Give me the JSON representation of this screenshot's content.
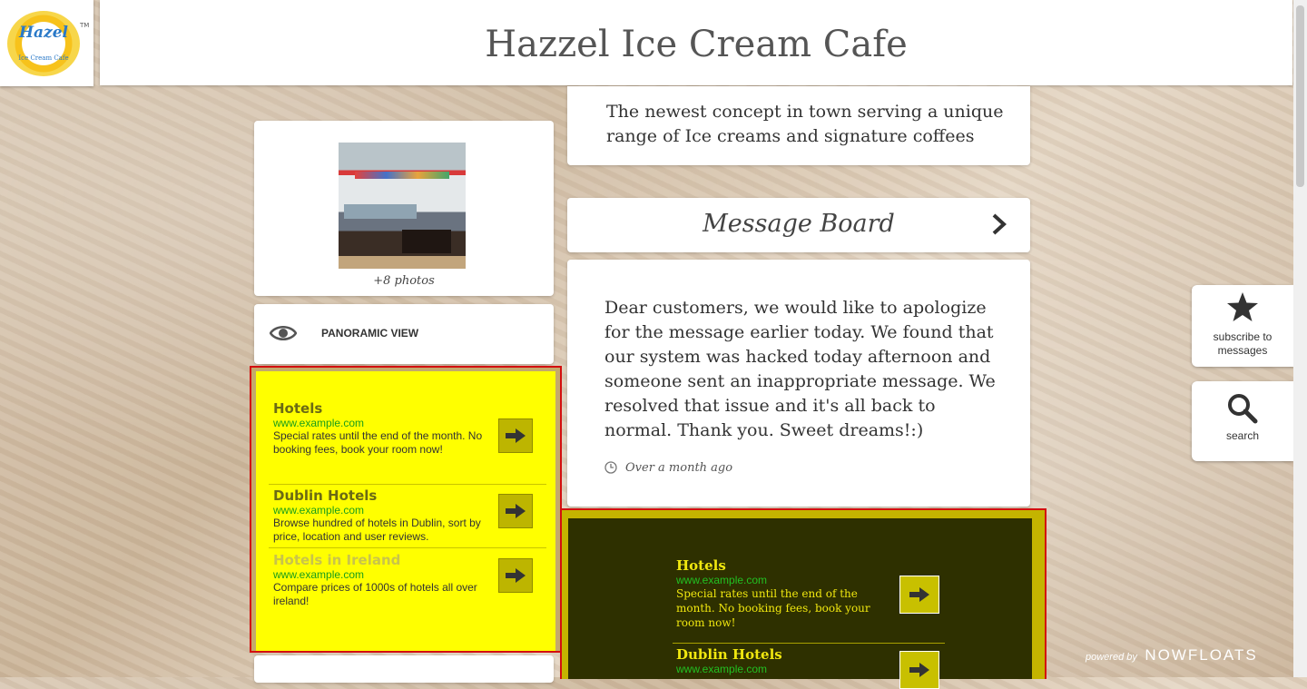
{
  "header": {
    "title": "Hazzel Ice Cream Cafe"
  },
  "logo": {
    "text": "Hazel",
    "subtext": "Ice Cream Cafe",
    "tm": "TM"
  },
  "gallery": {
    "caption": "+8 photos"
  },
  "panoramic": {
    "label": "PANORAMIC VIEW"
  },
  "ad_left": {
    "items": [
      {
        "title": "Hotels",
        "url": "www.example.com",
        "desc": "Special rates until the end of the month. No booking fees, book your room now!"
      },
      {
        "title": "Dublin Hotels",
        "url": "www.example.com",
        "desc": "Browse hundred of hotels in Dublin, sort by price, location and user reviews."
      },
      {
        "title": "Hotels in Ireland",
        "url": "www.example.com",
        "desc": "Compare prices of 1000s of hotels all over ireland!"
      }
    ]
  },
  "description": {
    "text": "The newest concept in town serving a unique range of Ice creams and signature coffees"
  },
  "message_board": {
    "title": "Message Board",
    "message": "Dear customers, we would like to apologize for the message earlier today. We found that our system was hacked today afternoon and someone sent an inappropriate message. We resolved that issue and it's all back to normal. Thank you. Sweet dreams!:)",
    "time": "Over a month ago"
  },
  "ad_bottom": {
    "items": [
      {
        "title": "Hotels",
        "url": "www.example.com",
        "desc": "Special rates until the end of the month. No booking fees, book your room now!"
      },
      {
        "title": "Dublin Hotels",
        "url": "www.example.com"
      }
    ]
  },
  "side": {
    "subscribe_label": "subscribe to messages",
    "search_label": "search"
  },
  "footer": {
    "powered_by": "powered by",
    "brand": "NOWFLOATS"
  },
  "colors": {
    "ad_yellow": "#ffff00",
    "ad_dark": "#2e3000",
    "ad_border": "#d30f0f"
  }
}
